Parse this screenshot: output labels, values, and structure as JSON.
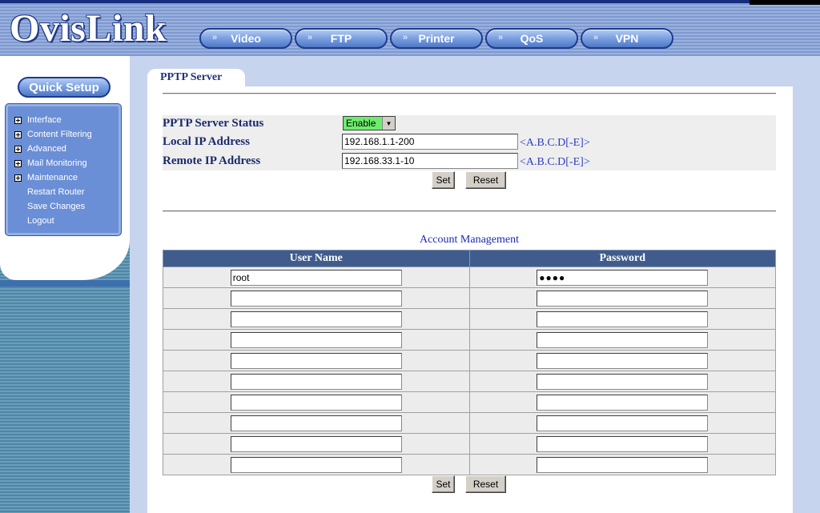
{
  "brand": {
    "logo_text": "OvisLink"
  },
  "top_nav": [
    {
      "label": "Video"
    },
    {
      "label": "FTP"
    },
    {
      "label": "Printer"
    },
    {
      "label": "QoS"
    },
    {
      "label": "VPN"
    }
  ],
  "sidebar": {
    "quick_setup_label": "Quick Setup",
    "items": [
      {
        "label": "Interface",
        "expandable": true
      },
      {
        "label": "Content Filtering",
        "expandable": true
      },
      {
        "label": "Advanced",
        "expandable": true
      },
      {
        "label": "Mail Monitoring",
        "expandable": true
      },
      {
        "label": "Maintenance",
        "expandable": true
      },
      {
        "label": "Restart Router",
        "expandable": false
      },
      {
        "label": "Save Changes",
        "expandable": false
      },
      {
        "label": "Logout",
        "expandable": false
      }
    ]
  },
  "page": {
    "tab_title": "PPTP Server",
    "status_label": "PPTP Server Status",
    "status_value": "Enable",
    "local_ip_label": "Local IP Address",
    "local_ip_value": "192.168.1.1-200",
    "local_ip_hint": "<A.B.C.D[-E]>",
    "remote_ip_label": "Remote IP Address",
    "remote_ip_value": "192.168.33.1-10",
    "remote_ip_hint": "<A.B.C.D[-E]>",
    "set_label": "Set",
    "reset_label": "Reset"
  },
  "accounts": {
    "title": "Account Management",
    "headers": {
      "user": "User Name",
      "password": "Password"
    },
    "rows": [
      {
        "user": "root",
        "password": "●●●●"
      },
      {
        "user": "",
        "password": ""
      },
      {
        "user": "",
        "password": ""
      },
      {
        "user": "",
        "password": ""
      },
      {
        "user": "",
        "password": ""
      },
      {
        "user": "",
        "password": ""
      },
      {
        "user": "",
        "password": ""
      },
      {
        "user": "",
        "password": ""
      },
      {
        "user": "",
        "password": ""
      },
      {
        "user": "",
        "password": ""
      }
    ],
    "set_label": "Set",
    "reset_label": "Reset"
  },
  "colors": {
    "header_blue": "#7f9ad0",
    "status_enabled_green": "#6cee6c",
    "table_header": "#3f5c8d",
    "hint_blue": "#2b3fbf"
  }
}
